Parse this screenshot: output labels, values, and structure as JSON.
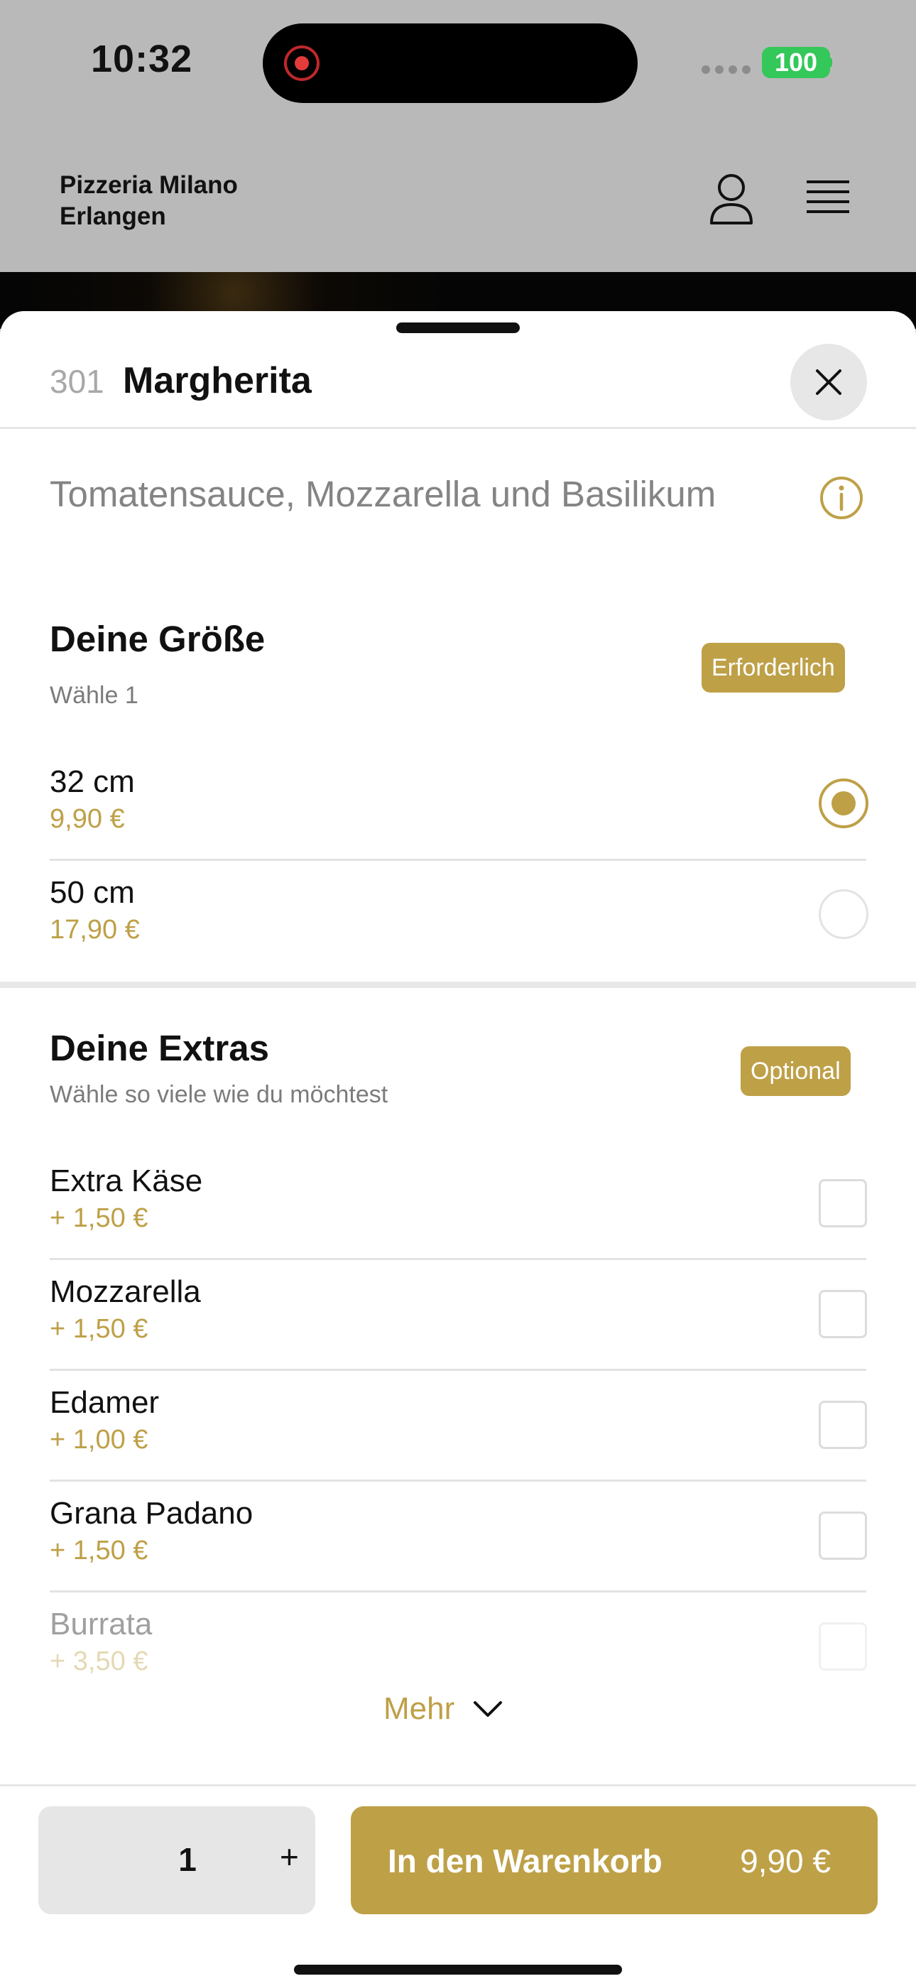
{
  "status_bar": {
    "time": "10:32",
    "battery": "100"
  },
  "header": {
    "restaurant_line1": "Pizzeria Milano",
    "restaurant_line2": "Erlangen"
  },
  "item": {
    "number": "301",
    "name": "Margherita",
    "description": "Tomatensauce, Mozzarella und Basilikum"
  },
  "size_section": {
    "title": "Deine Größe",
    "subtitle": "Wähle 1",
    "badge": "Erforderlich",
    "options": [
      {
        "name": "32 cm",
        "price": "9,90 €",
        "selected": true
      },
      {
        "name": "50 cm",
        "price": "17,90 €",
        "selected": false
      }
    ]
  },
  "extras_section": {
    "title": "Deine Extras",
    "subtitle": "Wähle so viele wie du möchtest",
    "badge": "Optional",
    "options": [
      {
        "name": "Extra Käse",
        "price": "+ 1,50 €"
      },
      {
        "name": "Mozzarella",
        "price": "+ 1,50 €"
      },
      {
        "name": "Edamer",
        "price": "+ 1,00 €"
      },
      {
        "name": "Grana Padano",
        "price": "+ 1,50 €"
      },
      {
        "name": "Burrata",
        "price": "+ 3,50 €"
      }
    ],
    "more_label": "Mehr"
  },
  "footer": {
    "quantity": "1",
    "plus": "+",
    "add_label": "In den Warenkorb",
    "add_price": "9,90 €"
  },
  "colors": {
    "accent": "#bea047",
    "header_bg": "#b9b9b9",
    "battery": "#34c759"
  }
}
